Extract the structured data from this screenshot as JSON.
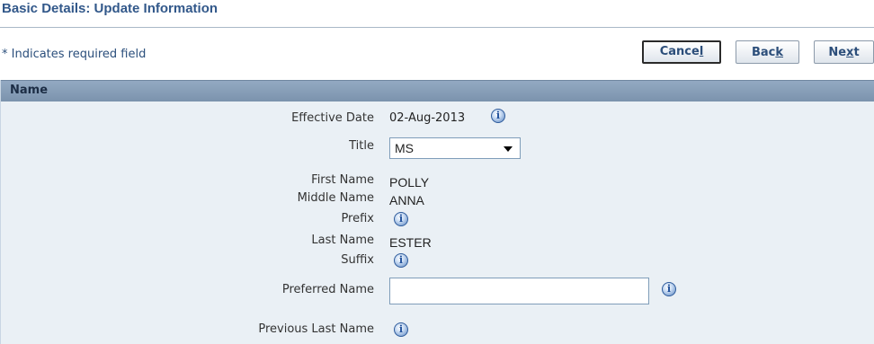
{
  "page": {
    "title": "Basic Details: Update Information",
    "required_note": "* Indicates required field"
  },
  "buttons": {
    "cancel": {
      "prefix": "Cance",
      "accel": "l",
      "suffix": ""
    },
    "back": {
      "prefix": "Bac",
      "accel": "k",
      "suffix": ""
    },
    "next": {
      "prefix": "Ne",
      "accel": "x",
      "suffix": "t"
    }
  },
  "section": {
    "title": "Name"
  },
  "fields": {
    "effective_date": {
      "label": "Effective Date",
      "value": "02-Aug-2013"
    },
    "title": {
      "label": "Title",
      "value": "MS"
    },
    "first_name": {
      "label": "First Name",
      "value": "POLLY"
    },
    "middle_name": {
      "label": "Middle Name",
      "value": "ANNA"
    },
    "prefix": {
      "label": "Prefix",
      "value": ""
    },
    "last_name": {
      "label": "Last Name",
      "value": "ESTER"
    },
    "suffix": {
      "label": "Suffix",
      "value": ""
    },
    "preferred_name": {
      "label": "Preferred Name",
      "value": ""
    },
    "previous_last_name": {
      "label": "Previous Last Name",
      "value": ""
    }
  },
  "icons": {
    "info": "info-icon",
    "dropdown": "chevron-down-icon"
  },
  "colors": {
    "title_text": "#32588a",
    "section_header": "#7b93ad",
    "form_background": "#eaf0f5",
    "button_text": "#2c4e7a"
  }
}
